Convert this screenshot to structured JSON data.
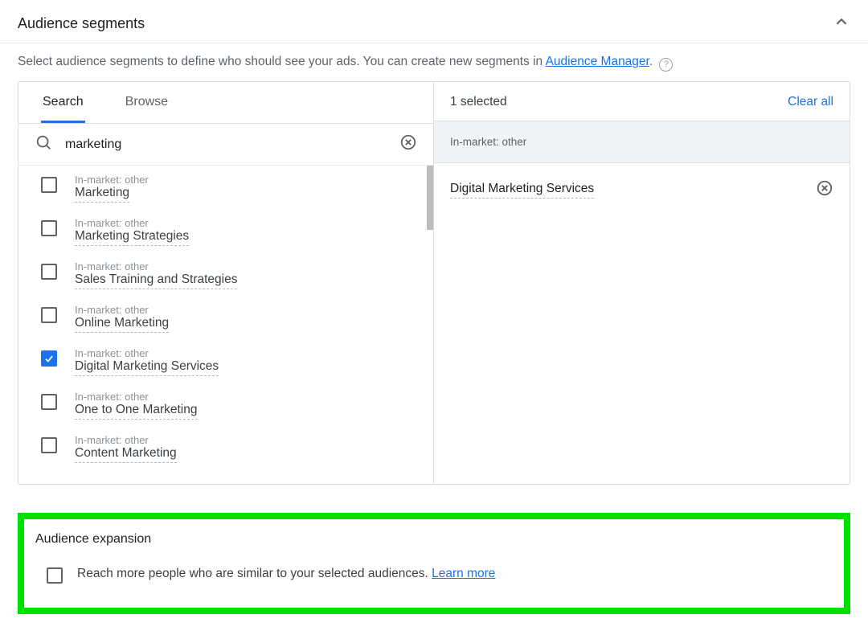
{
  "header": {
    "title": "Audience segments"
  },
  "description": {
    "prefix": "Select audience segments to define who should see your ads. You can create new segments in ",
    "link": "Audience Manager",
    "suffix": "."
  },
  "left": {
    "tabs": {
      "search": "Search",
      "browse": "Browse",
      "active": "search"
    },
    "search_value": "marketing",
    "results": [
      {
        "category": "In-market: other",
        "name": "Marketing",
        "checked": false
      },
      {
        "category": "In-market: other",
        "name": "Marketing Strategies",
        "checked": false
      },
      {
        "category": "In-market: other",
        "name": "Sales Training and Strategies",
        "checked": false
      },
      {
        "category": "In-market: other",
        "name": "Online Marketing",
        "checked": false
      },
      {
        "category": "In-market: other",
        "name": "Digital Marketing Services",
        "checked": true
      },
      {
        "category": "In-market: other",
        "name": "One to One Marketing",
        "checked": false
      },
      {
        "category": "In-market: other",
        "name": "Content Marketing",
        "checked": false
      }
    ]
  },
  "right": {
    "selected_count": "1 selected",
    "clear_all": "Clear all",
    "group_label": "In-market: other",
    "selected": [
      {
        "name": "Digital Marketing Services"
      }
    ]
  },
  "expansion": {
    "title": "Audience expansion",
    "text": "Reach more people who are similar to your selected audiences. ",
    "learn_more": "Learn more",
    "checked": false
  }
}
